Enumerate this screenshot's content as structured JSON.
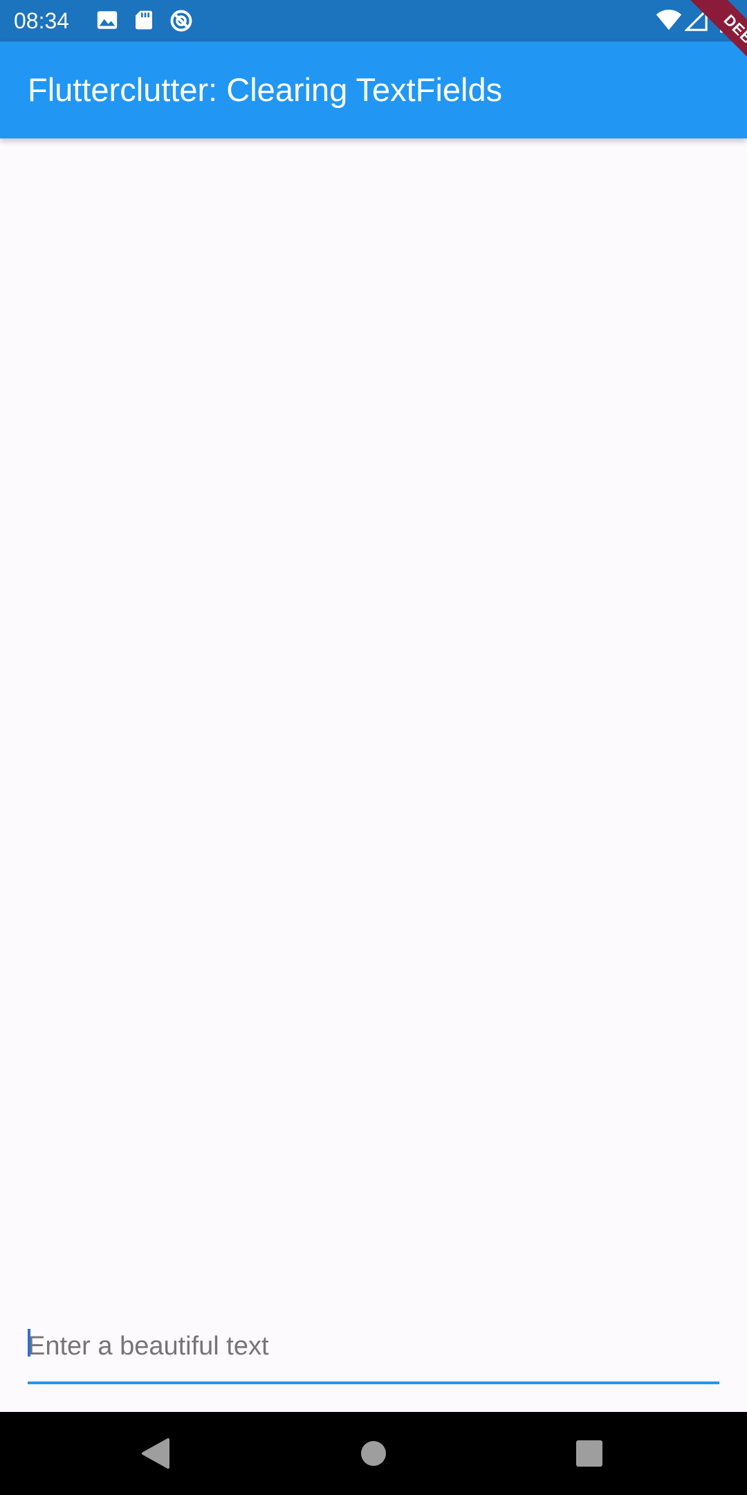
{
  "status_bar": {
    "time": "08:34",
    "left_icons": [
      "image-icon",
      "sd-card-icon",
      "sync-icon"
    ],
    "right_icons": [
      "wifi-icon",
      "cell-signal-icon",
      "battery-icon"
    ]
  },
  "app_bar": {
    "title": "Flutterclutter: Clearing TextFields",
    "color": "#2196f3"
  },
  "debug_banner": {
    "label": "DEBUG",
    "color": "#8a1c3a"
  },
  "text_field": {
    "value": "",
    "placeholder": "Enter a beautiful text",
    "accent": "#2196f3"
  },
  "nav_bar": {
    "buttons": [
      "back-icon",
      "home-icon",
      "recents-icon"
    ]
  }
}
